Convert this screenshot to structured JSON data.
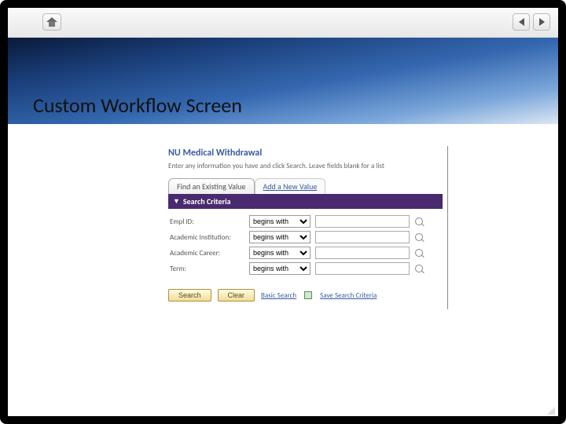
{
  "slide": {
    "title": "Custom Workflow Screen"
  },
  "module": {
    "title": "NU Medical Withdrawal",
    "instructions": "Enter any information you have and click Search. Leave fields blank for a list"
  },
  "tabs": {
    "active": "Find an Existing Value",
    "inactive": "Add a New Value"
  },
  "criteria": {
    "header": "Search Criteria",
    "twisty": "▼",
    "fields": [
      {
        "label": "Empl ID:",
        "op": "begins with",
        "value": ""
      },
      {
        "label": "Academic Institution:",
        "op": "begins with",
        "value": ""
      },
      {
        "label": "Academic Career:",
        "op": "begins with",
        "value": ""
      },
      {
        "label": "Term:",
        "op": "begins with",
        "value": ""
      }
    ]
  },
  "actions": {
    "search": "Search",
    "clear": "Clear",
    "basic": "Basic Search",
    "save": "Save Search Criteria"
  }
}
